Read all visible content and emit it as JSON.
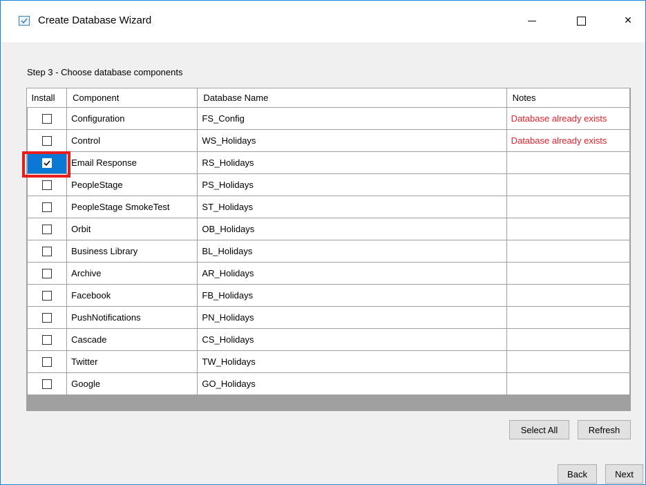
{
  "window": {
    "title": "Create Database Wizard",
    "controls": {
      "minimize": "minimize",
      "maximize": "maximize",
      "close": "×"
    }
  },
  "step_label": "Step 3 - Choose database components",
  "grid": {
    "columns": [
      "Install",
      "Component",
      "Database Name",
      "Notes"
    ],
    "rows": [
      {
        "install": false,
        "component": "Configuration",
        "database": "FS_Config",
        "notes": "Database already exists"
      },
      {
        "install": false,
        "component": "Control",
        "database": "WS_Holidays",
        "notes": "Database already exists"
      },
      {
        "install": true,
        "component": "Email Response",
        "database": "RS_Holidays",
        "notes": ""
      },
      {
        "install": false,
        "component": "PeopleStage",
        "database": "PS_Holidays",
        "notes": ""
      },
      {
        "install": false,
        "component": "PeopleStage SmokeTest",
        "database": "ST_Holidays",
        "notes": ""
      },
      {
        "install": false,
        "component": "Orbit",
        "database": "OB_Holidays",
        "notes": ""
      },
      {
        "install": false,
        "component": "Business Library",
        "database": "BL_Holidays",
        "notes": ""
      },
      {
        "install": false,
        "component": "Archive",
        "database": "AR_Holidays",
        "notes": ""
      },
      {
        "install": false,
        "component": "Facebook",
        "database": "FB_Holidays",
        "notes": ""
      },
      {
        "install": false,
        "component": "PushNotifications",
        "database": "PN_Holidays",
        "notes": ""
      },
      {
        "install": false,
        "component": "Cascade",
        "database": "CS_Holidays",
        "notes": ""
      },
      {
        "install": false,
        "component": "Twitter",
        "database": "TW_Holidays",
        "notes": ""
      },
      {
        "install": false,
        "component": "Google",
        "database": "GO_Holidays",
        "notes": ""
      }
    ]
  },
  "buttons": {
    "select_all": "Select All",
    "refresh": "Refresh",
    "back": "Back",
    "next": "Next"
  },
  "colors": {
    "window_border": "#1883d7",
    "note_text": "#e8212d",
    "selected_cell": "#0a78d4",
    "highlight": "#e81e1e"
  }
}
